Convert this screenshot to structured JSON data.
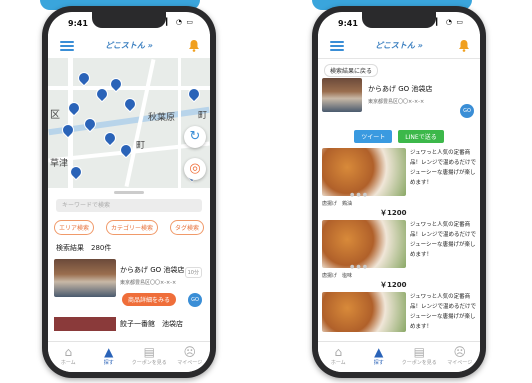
{
  "left_phone": {
    "status_time": "9:41",
    "status_icons": "▎▎▎ ◔ ▭",
    "logo": "どこストん »",
    "map_labels": [
      "区",
      "秋葉原",
      "町",
      "草津",
      "町"
    ],
    "search_placeholder": "キーワードで検索",
    "chips": [
      "エリア検索",
      "カテゴリー検索",
      "タグ検索"
    ],
    "result_count": "検索結果　280件",
    "item1": {
      "name": "からあげ GO 池袋店",
      "address": "東京都豊島区〇〇×-×-×",
      "time": "10分",
      "detail_button": "商品詳細をみる",
      "go_button": "GO"
    },
    "item2": {
      "name": "餃子一番館　池袋店"
    },
    "tabs": [
      {
        "icon": "⌂",
        "label": "ホーム"
      },
      {
        "icon": "▲",
        "label": "探す"
      },
      {
        "icon": "▤",
        "label": "クーポンを見る"
      },
      {
        "icon": "☹",
        "label": "マイページ"
      }
    ]
  },
  "right_phone": {
    "status_time": "9:41",
    "status_icons": "▎▎▎ ◔ ▭",
    "logo": "どこストん »",
    "back_button": "検索結果に戻る",
    "shop_name": "からあげ GO 池袋店",
    "shop_address": "東京都豊島区〇〇×-×-×",
    "tweet_button": "ツイート",
    "line_button": "LINEで送る",
    "products": [
      {
        "desc": "ジュワっと人気の定番商品！レンジで温めるだけでジューシーな唐揚げが楽しめます！",
        "category": "唐揚げ　鶏油",
        "price": "￥1200"
      },
      {
        "desc": "ジュワっと人気の定番商品！レンジで温めるだけでジューシーな唐揚げが楽しめます！",
        "category": "唐揚げ　塩味",
        "price": "￥1200"
      },
      {
        "desc": "ジュワっと人気の定番商品！レンジで温めるだけでジューシーな唐揚げが楽しめます！"
      }
    ],
    "tabs": [
      {
        "icon": "⌂",
        "label": "ホーム"
      },
      {
        "icon": "▲",
        "label": "探す"
      },
      {
        "icon": "▤",
        "label": "クーポンを見る"
      },
      {
        "icon": "☹",
        "label": "マイページ"
      }
    ]
  },
  "colors": {
    "accent": "#3a8ed6",
    "orange": "#ef6e3a",
    "twitter": "#3a9ae0",
    "line": "#3cb84a"
  }
}
